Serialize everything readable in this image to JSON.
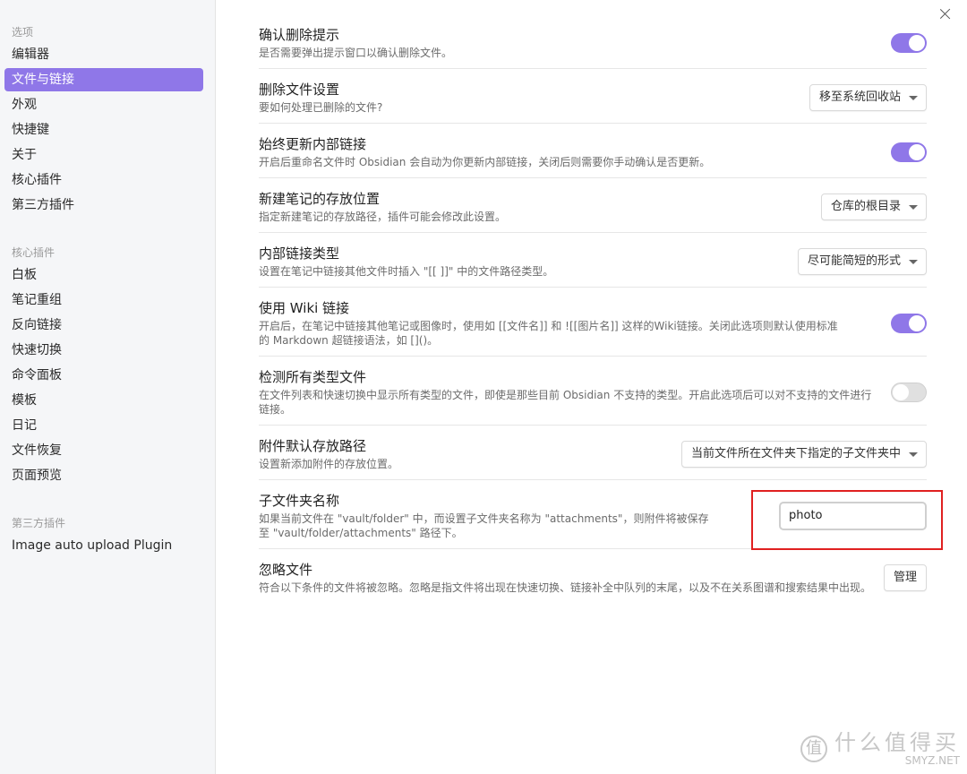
{
  "sidebar": {
    "sections": [
      {
        "title": "选项",
        "items": [
          {
            "label": "编辑器",
            "active": false
          },
          {
            "label": "文件与链接",
            "active": true
          },
          {
            "label": "外观",
            "active": false
          },
          {
            "label": "快捷键",
            "active": false
          },
          {
            "label": "关于",
            "active": false
          },
          {
            "label": "核心插件",
            "active": false
          },
          {
            "label": "第三方插件",
            "active": false
          }
        ]
      },
      {
        "title": "核心插件",
        "items": [
          {
            "label": "白板"
          },
          {
            "label": "笔记重组"
          },
          {
            "label": "反向链接"
          },
          {
            "label": "快速切换"
          },
          {
            "label": "命令面板"
          },
          {
            "label": "模板"
          },
          {
            "label": "日记"
          },
          {
            "label": "文件恢复"
          },
          {
            "label": "页面预览"
          }
        ]
      },
      {
        "title": "第三方插件",
        "items": [
          {
            "label": "Image auto upload Plugin"
          }
        ]
      }
    ]
  },
  "settings": {
    "confirm_delete": {
      "name": "确认删除提示",
      "desc": "是否需要弹出提示窗口以确认删除文件。",
      "enabled": true
    },
    "delete_files": {
      "name": "删除文件设置",
      "desc": "要如何处理已删除的文件?",
      "value": "移至系统回收站"
    },
    "update_links": {
      "name": "始终更新内部链接",
      "desc": "开启后重命名文件时 Obsidian 会自动为你更新内部链接，关闭后则需要你手动确认是否更新。",
      "enabled": true
    },
    "new_note_location": {
      "name": "新建笔记的存放位置",
      "desc": "指定新建笔记的存放路径，插件可能会修改此设置。",
      "value": "仓库的根目录"
    },
    "link_format": {
      "name": "内部链接类型",
      "desc": "设置在笔记中链接其他文件时插入 \"[[ ]]\" 中的文件路径类型。",
      "value": "尽可能简短的形式"
    },
    "wikilinks": {
      "name": "使用 Wiki 链接",
      "desc": "开启后，在笔记中链接其他笔记或图像时，使用如 [[文件名]] 和 ![[图片名]] 这样的Wiki链接。关闭此选项则默认使用标准的 Markdown 超链接语法，如 []()。",
      "enabled": true
    },
    "detect_all": {
      "name": "检测所有类型文件",
      "desc": "在文件列表和快速切换中显示所有类型的文件，即使是那些目前 Obsidian 不支持的类型。开启此选项后可以对不支持的文件进行链接。",
      "enabled": false
    },
    "attachment_path": {
      "name": "附件默认存放路径",
      "desc": "设置新添加附件的存放位置。",
      "value": "当前文件所在文件夹下指定的子文件夹中"
    },
    "subfolder_name": {
      "name": "子文件夹名称",
      "desc": "如果当前文件在 \"vault/folder\" 中，而设置子文件夹名称为 \"attachments\"，则附件将被保存至 \"vault/folder/attachments\" 路径下。",
      "value": "photo"
    },
    "ignore_files": {
      "name": "忽略文件",
      "desc": "符合以下条件的文件将被忽略。忽略是指文件将出现在快速切换、链接补全中队列的末尾，以及不在关系图谱和搜索结果中出现。",
      "button": "管理"
    }
  },
  "watermark": {
    "cn": "什么值得买",
    "en": "SMYZ.NET",
    "icon": "值"
  },
  "colors": {
    "accent": "#8f77e8",
    "highlight": "#e02020"
  }
}
